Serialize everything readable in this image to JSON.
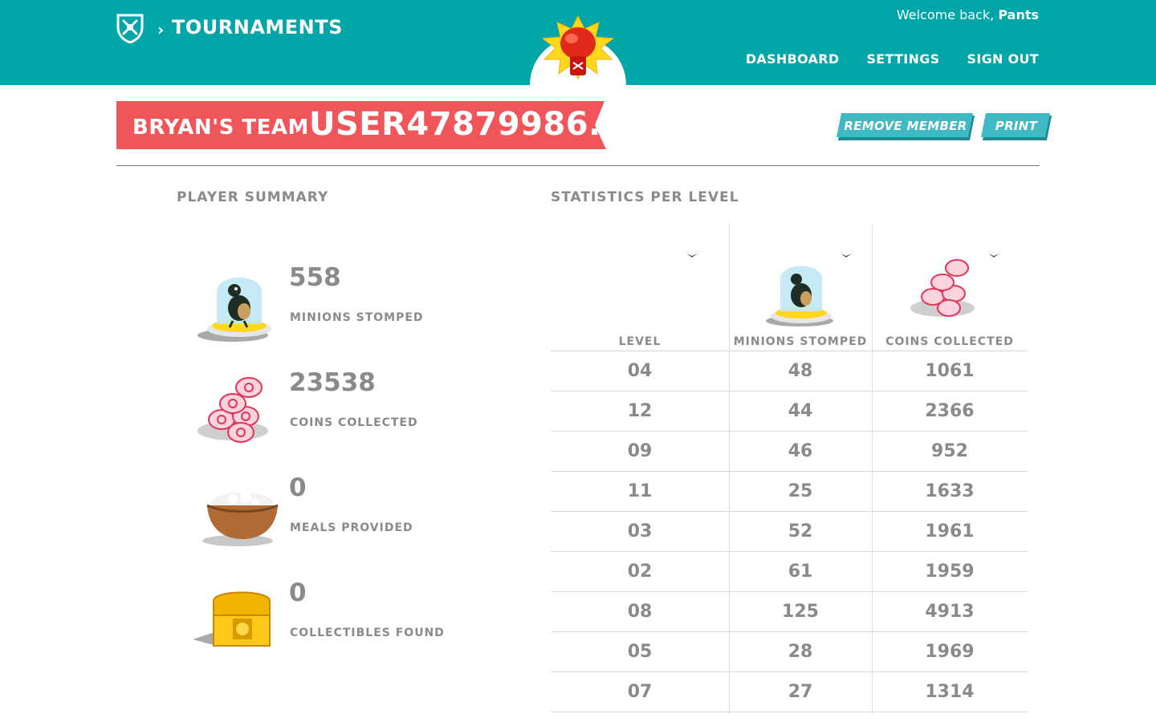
{
  "header": {
    "crumb_separator": "›",
    "crumb": "TOURNAMENTS",
    "welcome_prefix": "Welcome back,",
    "user_name": "Pants",
    "nav": {
      "dashboard": "DASHBOARD",
      "settings": "SETTINGS",
      "sign_out": "SIGN OUT"
    }
  },
  "title": {
    "team": "BRYAN'S TEAM",
    "separator": "›",
    "user": "USER47879986..."
  },
  "actions": {
    "remove_member": "REMOVE MEMBER",
    "print": "PRINT"
  },
  "colors": {
    "header_bg": "#00a5a8",
    "ribbon": "#f0555a",
    "button": "#3fb9c4",
    "button_shadow": "#1e8a94",
    "text_gray": "#8a8a8a"
  },
  "summary": {
    "heading": "PLAYER SUMMARY",
    "stats": [
      {
        "icon": "minion-dome-icon",
        "value": "558",
        "label": "MINIONS STOMPED"
      },
      {
        "icon": "coins-stack-icon",
        "value": "23538",
        "label": "COINS COLLECTED"
      },
      {
        "icon": "rice-bowl-icon",
        "value": "0",
        "label": "MEALS PROVIDED"
      },
      {
        "icon": "treasure-chest-icon",
        "value": "0",
        "label": "COLLECTIBLES FOUND"
      }
    ]
  },
  "levels": {
    "heading": "STATISTICS PER LEVEL",
    "columns": [
      "LEVEL",
      "MINIONS STOMPED",
      "COINS COLLECTED"
    ],
    "rows": [
      [
        "04",
        "48",
        "1061"
      ],
      [
        "12",
        "44",
        "2366"
      ],
      [
        "09",
        "46",
        "952"
      ],
      [
        "11",
        "25",
        "1633"
      ],
      [
        "03",
        "52",
        "1961"
      ],
      [
        "02",
        "61",
        "1959"
      ],
      [
        "08",
        "125",
        "4913"
      ],
      [
        "05",
        "28",
        "1969"
      ],
      [
        "07",
        "27",
        "1314"
      ]
    ]
  }
}
